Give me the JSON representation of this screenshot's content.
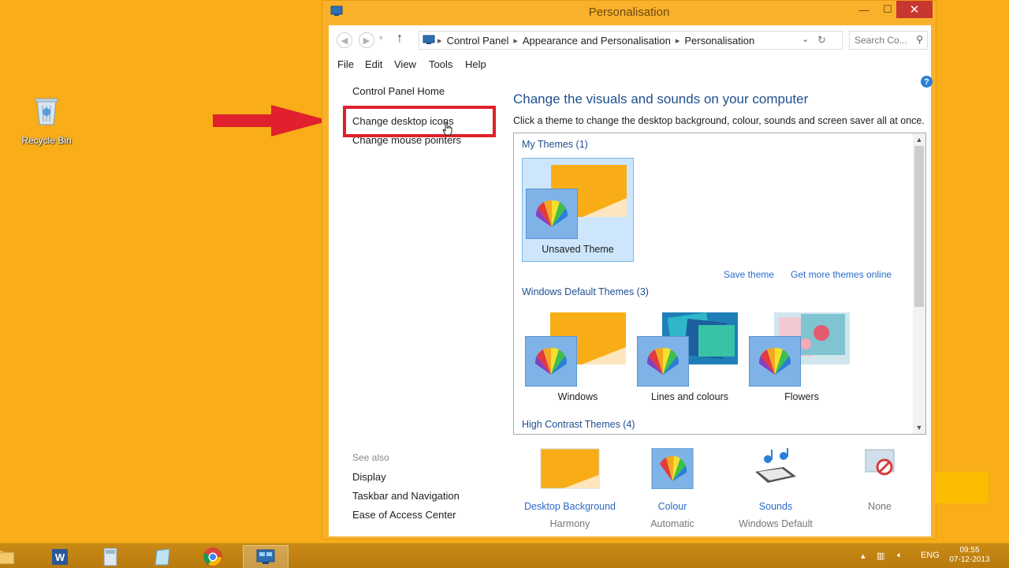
{
  "desktop": {
    "recycle_bin_label": "Recycle Bin"
  },
  "window": {
    "title": "Personalisation",
    "caption": {
      "minimize": "—",
      "maximize": "☐",
      "close": "✕"
    }
  },
  "addressbar": {
    "crumbs": [
      "Control Panel",
      "Appearance and Personalisation",
      "Personalisation"
    ],
    "search_placeholder": "Search Co..."
  },
  "menu": [
    "File",
    "Edit",
    "View",
    "Tools",
    "Help"
  ],
  "left_pane": {
    "home": "Control Panel Home",
    "links": [
      "Change desktop icons",
      "Change mouse pointers"
    ],
    "see_also_title": "See also",
    "see_also": [
      "Display",
      "Taskbar and Navigation",
      "Ease of Access Center"
    ]
  },
  "main": {
    "heading": "Change the visuals and sounds on your computer",
    "description": "Click a theme to change the desktop background, colour, sounds and screen saver all at once.",
    "my_themes_title": "My Themes (1)",
    "my_themes": [
      {
        "name": "Unsaved Theme",
        "selected": true
      }
    ],
    "save_theme": "Save theme",
    "get_more": "Get more themes online",
    "default_themes_title": "Windows Default Themes (3)",
    "default_themes": [
      {
        "name": "Windows"
      },
      {
        "name": "Lines and colours"
      },
      {
        "name": "Flowers"
      }
    ],
    "high_contrast_title": "High Contrast Themes (4)"
  },
  "settings": [
    {
      "label": "Desktop Background",
      "value": "Harmony"
    },
    {
      "label": "Colour",
      "value": "Automatic"
    },
    {
      "label": "Sounds",
      "value": "Windows Default"
    },
    {
      "label": "",
      "value": "None"
    }
  ],
  "taskbar": {
    "lang": "ENG",
    "time": "09:55",
    "date": "07-12-2013"
  },
  "colors": {
    "desktop": "#f9ad18",
    "highlight_red": "#e0202c",
    "link_blue": "#2a6ac7"
  }
}
